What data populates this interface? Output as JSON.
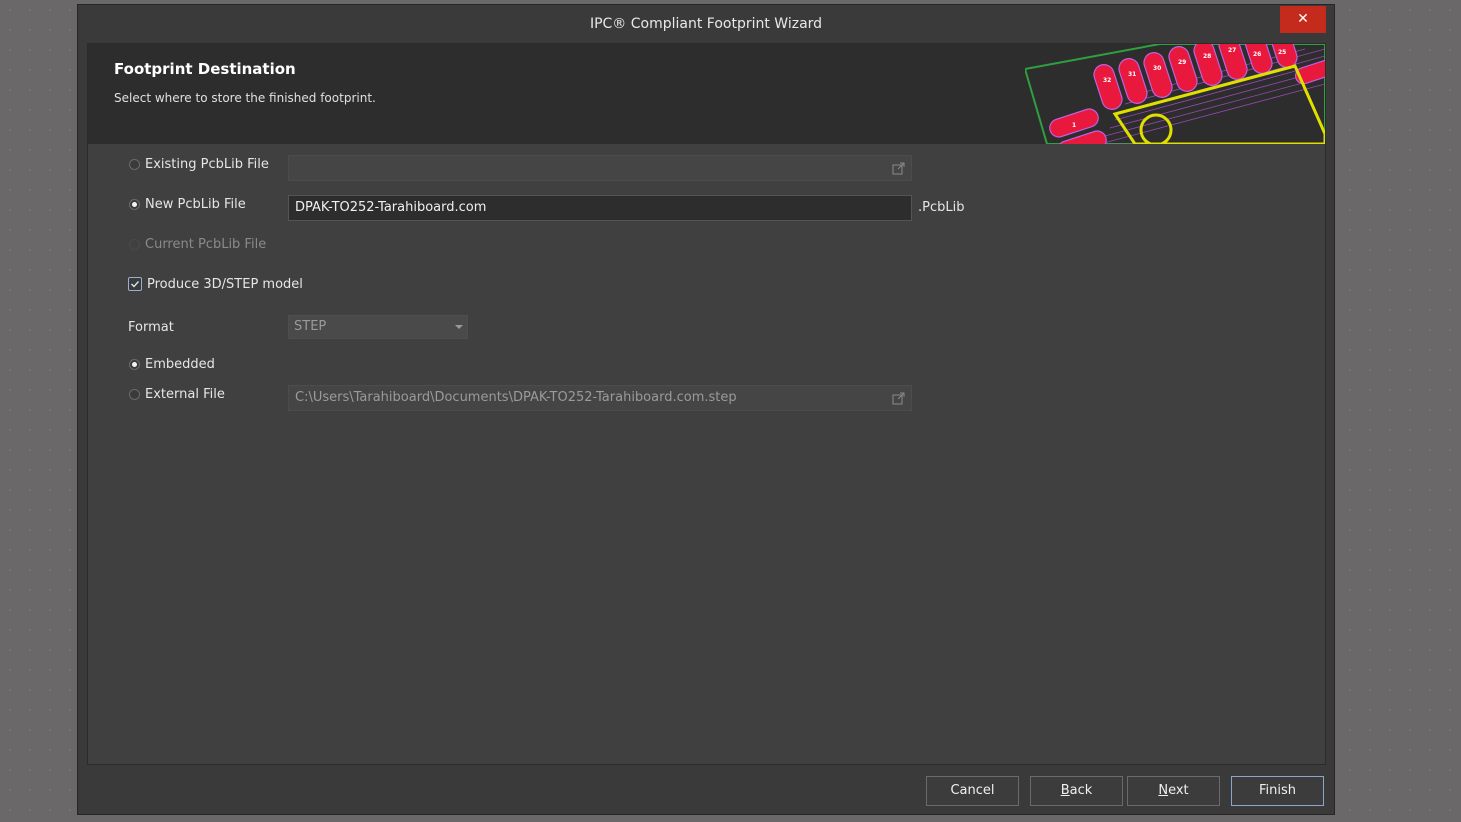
{
  "window": {
    "title": "IPC® Compliant Footprint Wizard",
    "close_label": "✕"
  },
  "header": {
    "title": "Footprint Destination",
    "subtitle": "Select where to store the finished footprint.",
    "pad_labels": [
      "32",
      "31",
      "30",
      "29",
      "28",
      "27",
      "26",
      "25",
      "1"
    ]
  },
  "destination": {
    "existing_label": "Existing PcbLib File",
    "existing_value": "",
    "new_label": "New PcbLib File",
    "new_value": "DPAK-TO252-Tarahiboard.com",
    "new_suffix": ".PcbLib",
    "current_label": "Current PcbLib File",
    "selected": "new"
  },
  "model": {
    "produce_label": "Produce 3D/STEP model",
    "produce_checked": true,
    "format_label": "Format",
    "format_value": "STEP",
    "embedded_label": "Embedded",
    "external_label": "External File",
    "external_value": "C:\\Users\\Tarahiboard\\Documents\\DPAK-TO252-Tarahiboard.com.step",
    "storage_selected": "embedded"
  },
  "buttons": {
    "cancel": "Cancel",
    "back_mnemonic": "B",
    "back_rest": "ack",
    "next_mnemonic": "N",
    "next_rest": "ext",
    "finish": "Finish"
  },
  "colors": {
    "accent_border": "#8aa6cc",
    "close_button": "#c42b1c",
    "pad": "#e8193c",
    "silkscreen": "#e0e000",
    "board_outline": "#2fa040"
  }
}
